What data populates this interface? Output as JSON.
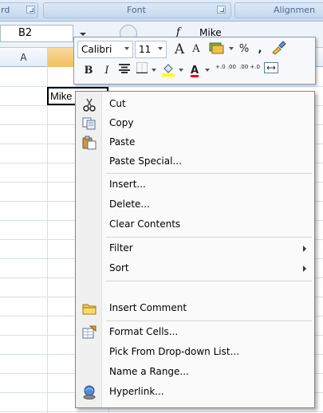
{
  "ribbon": {
    "groups": [
      {
        "label": "rd"
      },
      {
        "label": "Font"
      },
      {
        "label": "Alignmen"
      }
    ]
  },
  "formula_bar": {
    "name_box": "B2",
    "fx": "f",
    "value": "Mike"
  },
  "columns": [
    "A",
    ""
  ],
  "active_cell": {
    "value": "Mike"
  },
  "mini_toolbar": {
    "font_name": "Calibri",
    "font_size": "11",
    "grow_font": "A",
    "shrink_font": "A",
    "percent": "%",
    "comma": ",",
    "bold": "B",
    "italic": "I",
    "font_color_letter": "A",
    "inc_decimal": "+.0 .00",
    "dec_decimal": ".00 +.0",
    "highlight_color": "#ffff00",
    "font_color": "#ff0000"
  },
  "context_menu": {
    "items": [
      {
        "label": "Cut",
        "icon": "scissors-icon"
      },
      {
        "label": "Copy",
        "icon": "copy-icon"
      },
      {
        "label": "Paste",
        "icon": "paste-icon"
      },
      {
        "label": "Paste Special...",
        "icon": ""
      },
      {
        "label": "Insert...",
        "icon": ""
      },
      {
        "label": "Delete...",
        "icon": ""
      },
      {
        "label": "Clear Contents",
        "icon": ""
      },
      {
        "label": "Filter",
        "icon": "",
        "submenu": true
      },
      {
        "label": "Sort",
        "icon": "",
        "submenu": true
      },
      {
        "label": "Insert Comment",
        "icon": "comment-icon"
      },
      {
        "label": "Format Cells...",
        "icon": "format-cells-icon"
      },
      {
        "label": "Pick From Drop-down List...",
        "icon": ""
      },
      {
        "label": "Name a Range...",
        "icon": ""
      },
      {
        "label": "Hyperlink...",
        "icon": "hyperlink-icon"
      }
    ]
  }
}
